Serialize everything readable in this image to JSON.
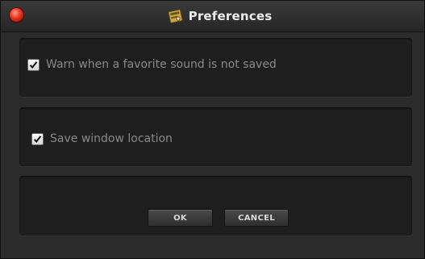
{
  "window": {
    "title": "Preferences",
    "title_icon": "preferences-app-icon"
  },
  "options": [
    {
      "label": "Warn when a favorite sound is not saved",
      "checked": true
    },
    {
      "label": "Save window location",
      "checked": true
    }
  ],
  "buttons": {
    "ok_label": "OK",
    "cancel_label": "CANCEL"
  },
  "colors": {
    "window_bg": "#2b2b2b",
    "panel_bg": "#1e1e1e",
    "close_button": "#e8321e",
    "label_text": "#8a8a8a"
  }
}
